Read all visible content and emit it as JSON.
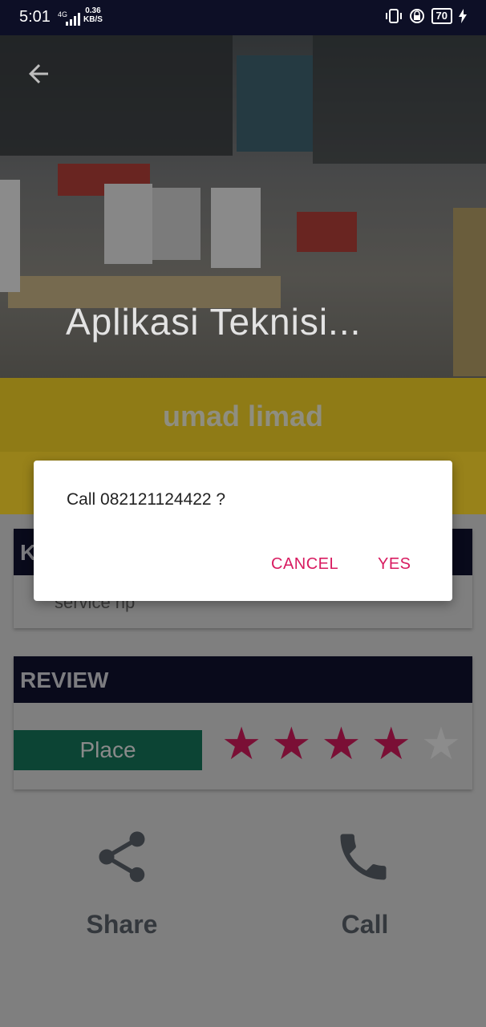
{
  "status_bar": {
    "time": "5:01",
    "network": "4G",
    "speed_value": "0.36",
    "speed_unit": "KB/S",
    "battery": "70"
  },
  "header": {
    "title": "Aplikasi Teknisi..."
  },
  "profile": {
    "name": "umad limad"
  },
  "category_card": {
    "heading": "K",
    "value": "service hp"
  },
  "review_card": {
    "heading": "REVIEW",
    "place_label": "Place",
    "rating": 4,
    "max_rating": 5
  },
  "actions": {
    "share_label": "Share",
    "call_label": "Call"
  },
  "dialog": {
    "message": "Call 082121124422 ?",
    "cancel_label": "CANCEL",
    "yes_label": "YES"
  },
  "colors": {
    "accent": "#d81b60",
    "star_filled": "#7a0f35",
    "star_empty": "#8c8c8c",
    "header_bar": "#090a1b",
    "place_bar": "#0c4434"
  }
}
